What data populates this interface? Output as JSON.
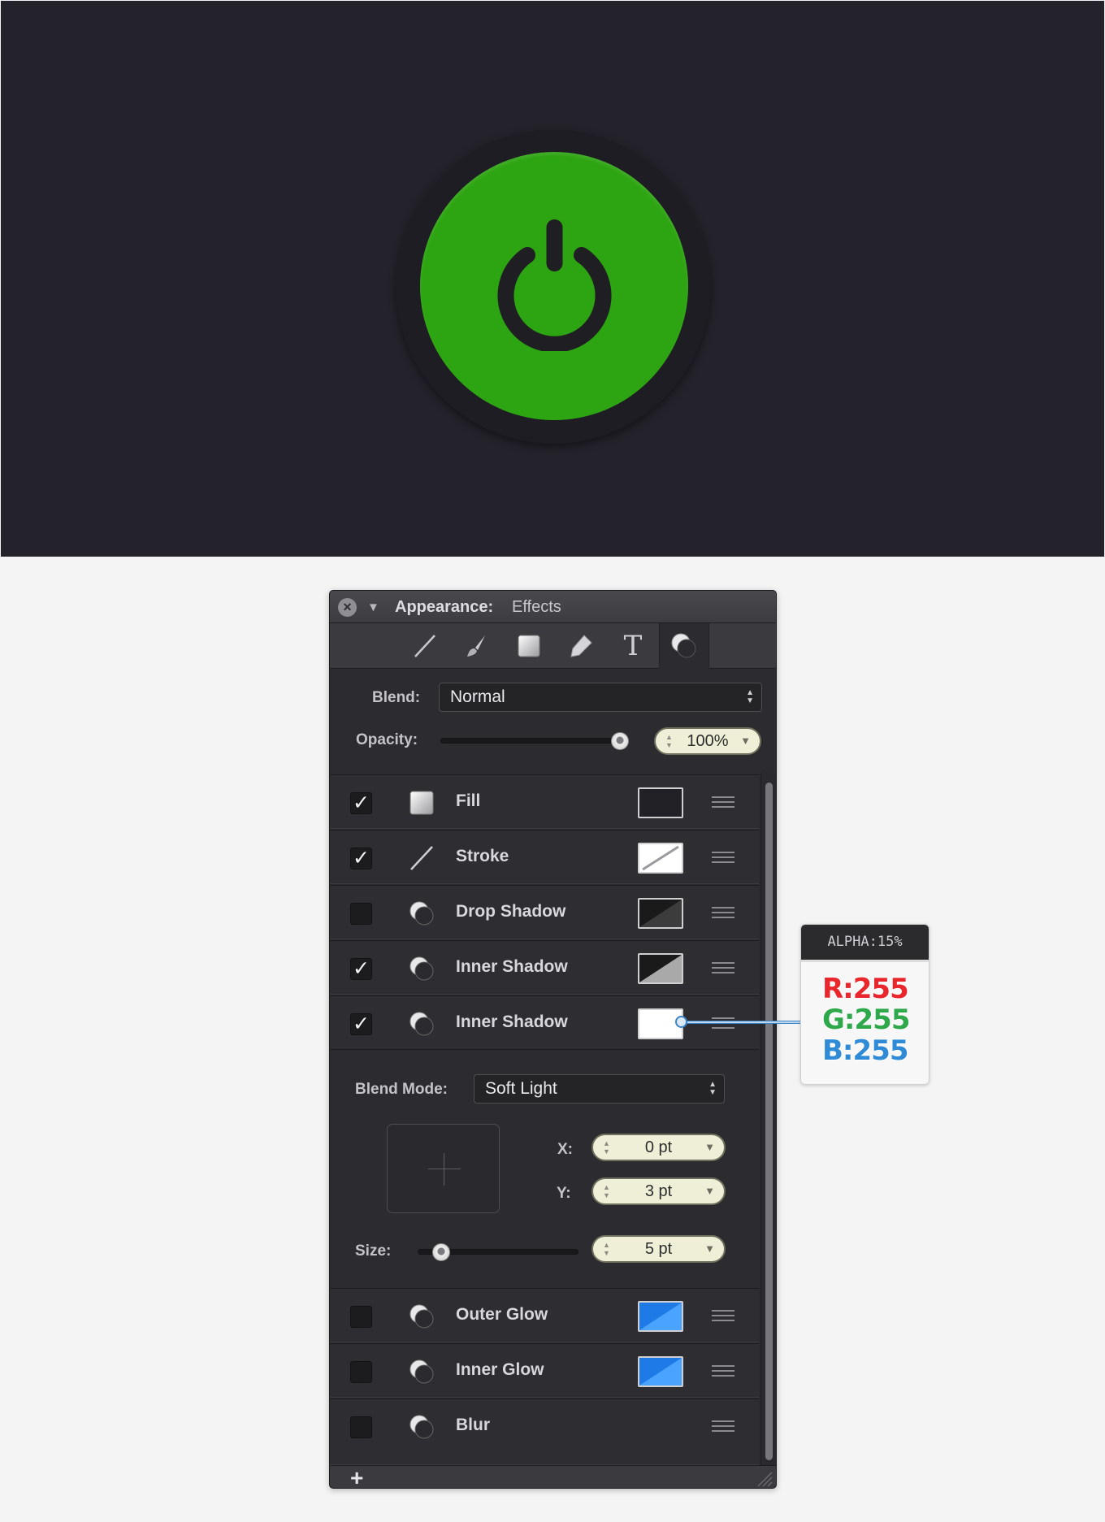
{
  "panel": {
    "title": "Appearance:",
    "subtitle": "Effects",
    "toolbar": [
      "line-tool-icon",
      "brush-tool-icon",
      "shape-fill-icon",
      "pen-tool-icon",
      "text-tool-icon",
      "effects-tool-icon"
    ],
    "blend_label": "Blend:",
    "blend_value": "Normal",
    "opacity_label": "Opacity:",
    "opacity_value": "100%",
    "opacity_fraction": 1.0
  },
  "effects": [
    {
      "label": "Fill",
      "checked": "✓",
      "swatch": "#222226"
    },
    {
      "label": "Stroke",
      "checked": "✓",
      "swatch": "white-with-slash"
    },
    {
      "label": "Drop Shadow",
      "checked": "",
      "swatch": "black-diagonal"
    },
    {
      "label": "Inner Shadow",
      "checked": "✓",
      "swatch": "gray-diagonal"
    },
    {
      "label": "Inner Shadow",
      "checked": "✓",
      "swatch": "#ffffff"
    },
    {
      "label": "Outer Glow",
      "checked": "",
      "swatch": "#2a8ef5"
    },
    {
      "label": "Inner Glow",
      "checked": "",
      "swatch": "#2a8ef5"
    },
    {
      "label": "Blur",
      "checked": "",
      "swatch": ""
    }
  ],
  "detail": {
    "blend_mode_label": "Blend Mode:",
    "blend_mode_value": "Soft Light",
    "x_label": "X:",
    "x_value": "0 pt",
    "y_label": "Y:",
    "y_value": "3 pt",
    "size_label": "Size:",
    "size_value": "5 pt",
    "size_fraction": 0.1
  },
  "footer": {
    "add_label": "+"
  },
  "callout": {
    "alpha": "ALPHA:15%",
    "r": "R:255",
    "g": "G:255",
    "b": "B:255",
    "colors": {
      "r": "#e8262b",
      "g": "#2ea84a",
      "b": "#2f8bd6"
    }
  },
  "colors": {
    "canvas": "#24232b",
    "button_green": "#2da411",
    "accent_blue": "#2a8ef5"
  }
}
